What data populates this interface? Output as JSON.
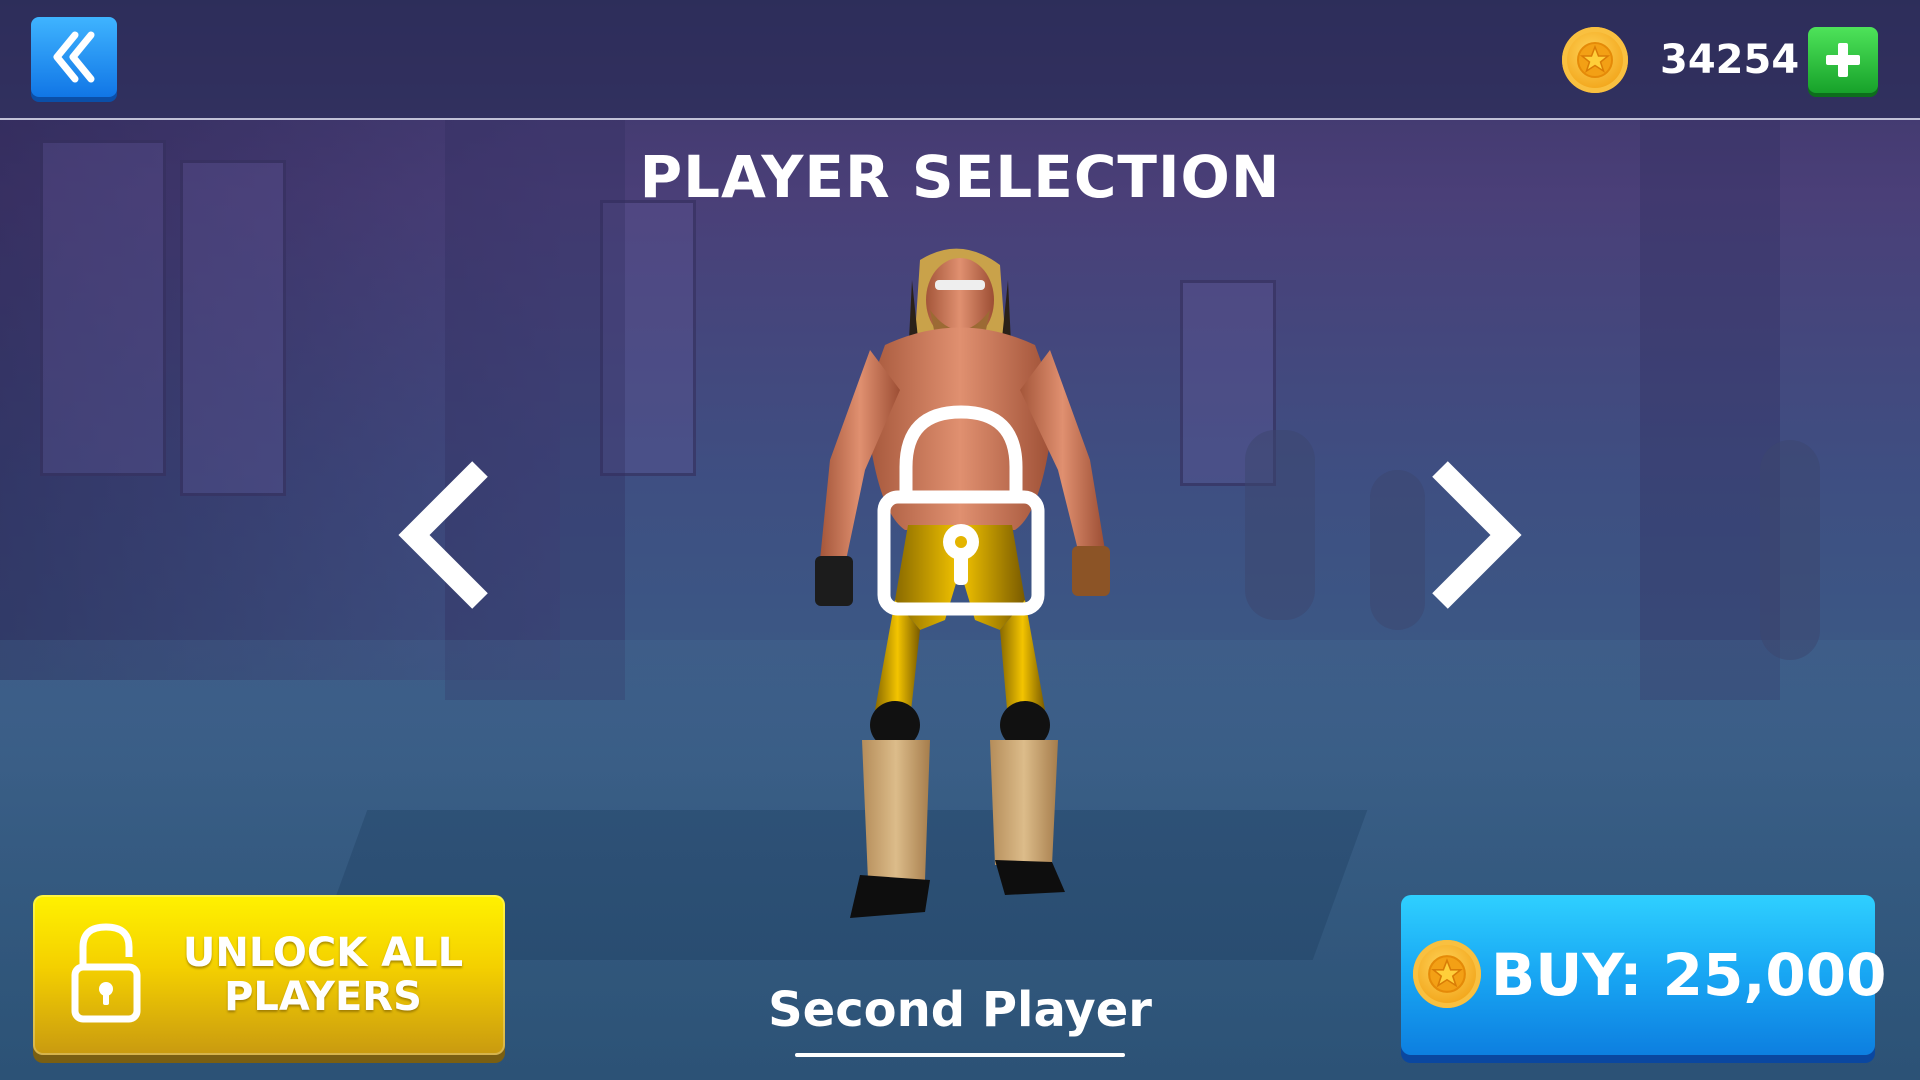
{
  "header": {
    "coins": "34254"
  },
  "title": "PLAYER SELECTION",
  "player": {
    "name": "Second Player",
    "locked": true
  },
  "unlock_button": {
    "label": "UNLOCK ALL\nPLAYERS"
  },
  "buy_button": {
    "label": "BUY: 25,000"
  },
  "icons": {
    "back": "back-double-chevron-icon",
    "coin": "coin-icon",
    "add": "plus-icon",
    "lock": "padlock-icon",
    "prev": "chevron-left-icon",
    "next": "chevron-right-icon"
  },
  "colors": {
    "back_button": "#1a8cf0",
    "add_button": "#22b838",
    "unlock_button": "#f4d000",
    "buy_button": "#18a6f3",
    "coin": "#f2a51a"
  }
}
